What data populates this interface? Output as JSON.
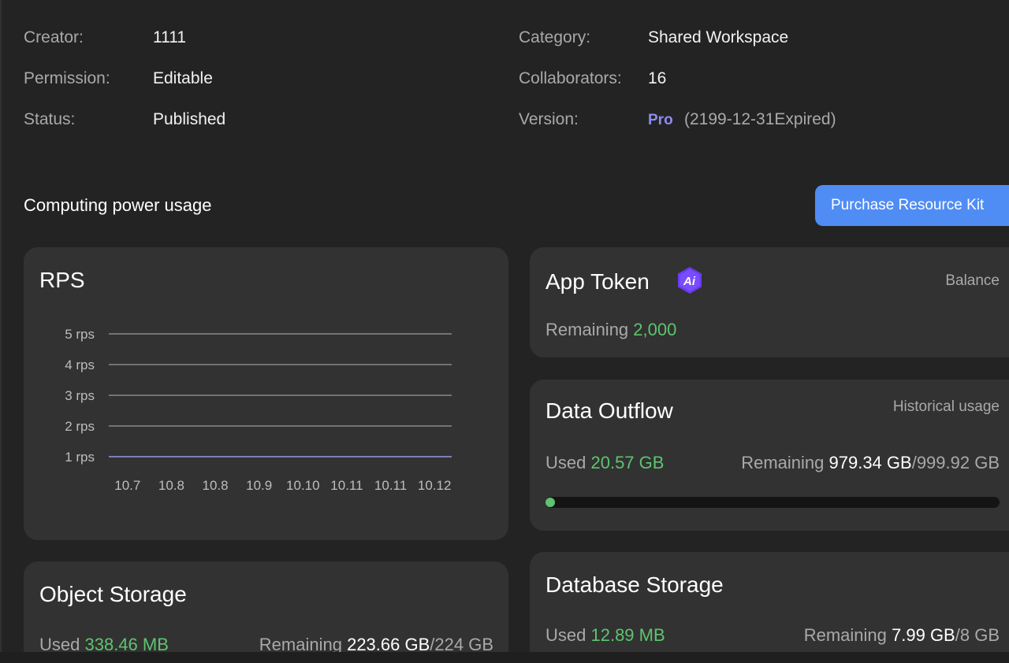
{
  "info": {
    "creator_label": "Creator:",
    "creator_value": "1111",
    "permission_label": "Permission:",
    "permission_value": "Editable",
    "status_label": "Status:",
    "status_value": "Published",
    "category_label": "Category:",
    "category_value": "Shared Workspace",
    "collaborators_label": "Collaborators:",
    "collaborators_value": "16",
    "version_label": "Version:",
    "version_badge": "Pro",
    "version_expiry": "(2199-12-31Expired)"
  },
  "section": {
    "title": "Computing power usage",
    "purchase_button": "Purchase Resource Kit"
  },
  "rps": {
    "title": "RPS",
    "chart_data": {
      "type": "line",
      "categories": [
        "10.7",
        "10.8",
        "10.8",
        "10.9",
        "10.10",
        "10.11",
        "10.11",
        "10.12"
      ],
      "yticks": [
        "1 rps",
        "2 rps",
        "3 rps",
        "4 rps",
        "5 rps"
      ],
      "ylim": [
        1,
        5
      ],
      "series": [
        {
          "values": [
            1,
            1,
            1,
            1,
            1,
            1,
            1,
            1
          ]
        }
      ],
      "line_color": "#8f8fd8",
      "grid": true
    }
  },
  "app_token": {
    "title": "App Token",
    "icon": "ai-icon",
    "note": "Balance",
    "remaining_label": "Remaining",
    "remaining_value": "2,000"
  },
  "data_outflow": {
    "title": "Data Outflow",
    "note": "Historical usage",
    "used_label": "Used",
    "used_value": "20.57 GB",
    "remaining_label": "Remaining",
    "remaining_value": "979.34 GB",
    "separator": "/",
    "total_value": "999.92 GB",
    "progress_fraction": 0.0206
  },
  "object_storage": {
    "title": "Object Storage",
    "used_label": "Used",
    "used_value": "338.46 MB",
    "remaining_label": "Remaining",
    "remaining_value": "223.66 GB",
    "separator": "/",
    "total_value": "224 GB"
  },
  "database_storage": {
    "title": "Database Storage",
    "used_label": "Used",
    "used_value": "12.89 MB",
    "remaining_label": "Remaining",
    "remaining_value": "7.99 GB",
    "separator": "/",
    "total_value": "8 GB"
  },
  "colors": {
    "accent": "#4f8df5",
    "green": "#5ec46f",
    "pro": "#8b8cf4"
  }
}
